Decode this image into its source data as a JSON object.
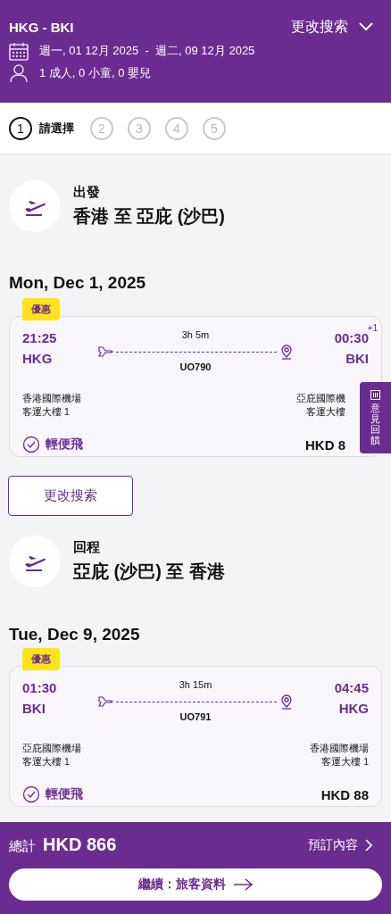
{
  "header": {
    "route": "HKG - BKI",
    "change_search": "更改搜索",
    "dates": "週一, 01 12月 2025  -  週二, 09 12月 2025",
    "passengers": "1 成人, 0 小童, 0 嬰兒"
  },
  "steps": [
    {
      "label": "1",
      "text": "請選擇",
      "selected": true
    },
    {
      "label": "2",
      "selected": false
    },
    {
      "label": "3",
      "selected": false
    },
    {
      "label": "4",
      "selected": false
    },
    {
      "label": "5",
      "selected": false
    }
  ],
  "sections": [
    {
      "title": "出發",
      "route": "香港 至 亞庇 (沙巴)",
      "date": "Mon, Dec 1, 2025",
      "flight": {
        "badge": "優惠",
        "dep_time": "21:25",
        "dep_code": "HKG",
        "arr_time": "00:30",
        "day_offset": "+1",
        "arr_code": "BKI",
        "duration": "3h 5m",
        "flight_no": "UO790",
        "dep_airport": "香港國際機場",
        "dep_terminal": "客運大樓 1",
        "arr_airport": "亞庇國際機",
        "arr_terminal": "客運大樓",
        "fare": "輕便飛",
        "price": "HKD 8"
      },
      "action": "更改搜索"
    },
    {
      "title": "回程",
      "route": "亞庇 (沙巴) 至 香港",
      "date": "Tue, Dec 9, 2025",
      "flight": {
        "badge": "優惠",
        "dep_time": "01:30",
        "dep_code": "BKI",
        "arr_time": "04:45",
        "arr_code": "HKG",
        "duration": "3h 15m",
        "flight_no": "UO791",
        "dep_airport": "亞庇國際機場",
        "dep_terminal": "客運大樓 1",
        "arr_airport": "香港國際機場",
        "arr_terminal": "客運大樓 1",
        "fare": "輕便飛",
        "price": "HKD 88"
      }
    }
  ],
  "feedback": {
    "label": "意見回饋"
  },
  "footer": {
    "total_label": "總計",
    "total": "HKD 866",
    "details": "預訂內容",
    "continue": "繼續：旅客資料"
  }
}
